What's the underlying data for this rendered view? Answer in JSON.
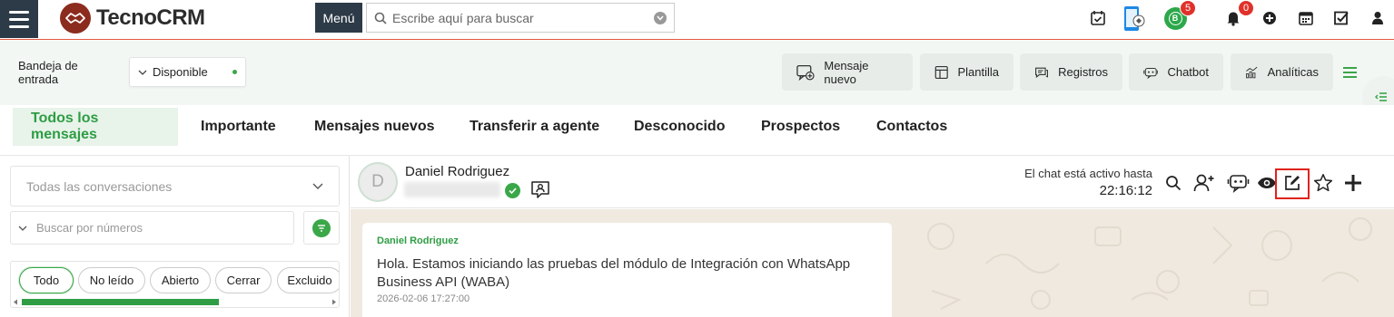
{
  "app": {
    "brand": "TecnoCRM",
    "menu_label": "Menú",
    "search_placeholder": "Escribe aquí para buscar"
  },
  "topbar_icons": [
    {
      "name": "calendar-check-icon"
    },
    {
      "name": "phone-app-icon"
    },
    {
      "name": "whatsapp-business-icon",
      "badge": "5"
    },
    {
      "name": "bell-icon",
      "badge": "0"
    },
    {
      "name": "plus-circle-icon"
    },
    {
      "name": "calendar-icon"
    },
    {
      "name": "checkbox-icon"
    },
    {
      "name": "user-icon"
    }
  ],
  "inbox": {
    "label": "Bandeja de entrada",
    "status": "Disponible",
    "actions": [
      {
        "label": "Mensaje nuevo",
        "icon": "new-message-icon"
      },
      {
        "label": "Plantilla",
        "icon": "template-icon"
      },
      {
        "label": "Registros",
        "icon": "records-icon"
      },
      {
        "label": "Chatbot",
        "icon": "chatbot-icon"
      },
      {
        "label": "Analíticas",
        "icon": "analytics-icon"
      }
    ]
  },
  "tabs": [
    {
      "label": "Todos los mensajes",
      "active": true
    },
    {
      "label": "Importante",
      "active": false
    },
    {
      "label": "Mensajes nuevos",
      "active": false
    },
    {
      "label": "Transferir a agente",
      "active": false
    },
    {
      "label": "Desconocido",
      "active": false
    },
    {
      "label": "Prospectos",
      "active": false
    },
    {
      "label": "Contactos",
      "active": false
    }
  ],
  "left_panel": {
    "conversation_filter": "Todas las conversaciones",
    "number_search_placeholder": "Buscar por números",
    "chips": [
      {
        "label": "Todo",
        "active": true
      },
      {
        "label": "No leído",
        "active": false
      },
      {
        "label": "Abierto",
        "active": false
      },
      {
        "label": "Cerrar",
        "active": false
      },
      {
        "label": "Excluido",
        "active": false
      }
    ]
  },
  "chat": {
    "avatar_initial": "D",
    "contact_name": "Daniel Rodriguez",
    "active_label": "El chat está activo hasta",
    "active_time": "22:16:12",
    "header_icons": [
      "search-icon",
      "add-user-icon",
      "chatbot-icon",
      "eye-icon",
      "edit-note-icon",
      "star-icon",
      "plus-icon"
    ],
    "messages": [
      {
        "sender": "Daniel Rodriguez",
        "text": "Hola. Estamos iniciando las pruebas del módulo de Integración con WhatsApp Business API (WABA)",
        "time": "2026-02-06 17:27:00"
      }
    ]
  },
  "colors": {
    "accent": "#2e9d44",
    "dark": "#2d3a47",
    "brand_red": "#8b2c1e",
    "highlight": "#e0231d"
  }
}
